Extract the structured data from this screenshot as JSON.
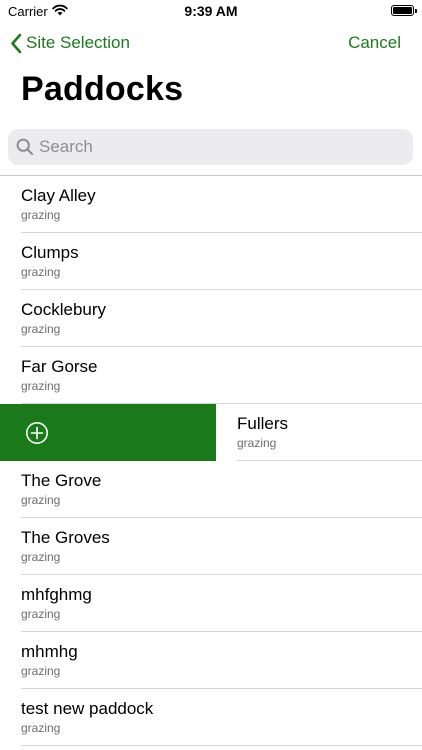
{
  "status_bar": {
    "carrier": "Carrier",
    "time": "9:39 AM"
  },
  "nav": {
    "back_label": "Site Selection",
    "cancel_label": "Cancel"
  },
  "title": "Paddocks",
  "search": {
    "placeholder": "Search",
    "value": ""
  },
  "colors": {
    "accent": "#1e7a1e",
    "swipe_action": "#1a7a1a"
  },
  "paddocks": [
    {
      "name": "Clay Alley",
      "type": "grazing"
    },
    {
      "name": "Clumps",
      "type": "grazing"
    },
    {
      "name": "Cocklebury",
      "type": "grazing"
    },
    {
      "name": "Far Gorse",
      "type": "grazing"
    },
    {
      "name": "Fullers",
      "type": "grazing",
      "swiped": true,
      "swipe_action_icon": "add-circle-icon"
    },
    {
      "name": "The Grove",
      "type": "grazing"
    },
    {
      "name": "The Groves",
      "type": "grazing"
    },
    {
      "name": "mhfghmg",
      "type": "grazing"
    },
    {
      "name": "mhmhg",
      "type": "grazing"
    },
    {
      "name": "test new paddock",
      "type": "grazing"
    }
  ]
}
